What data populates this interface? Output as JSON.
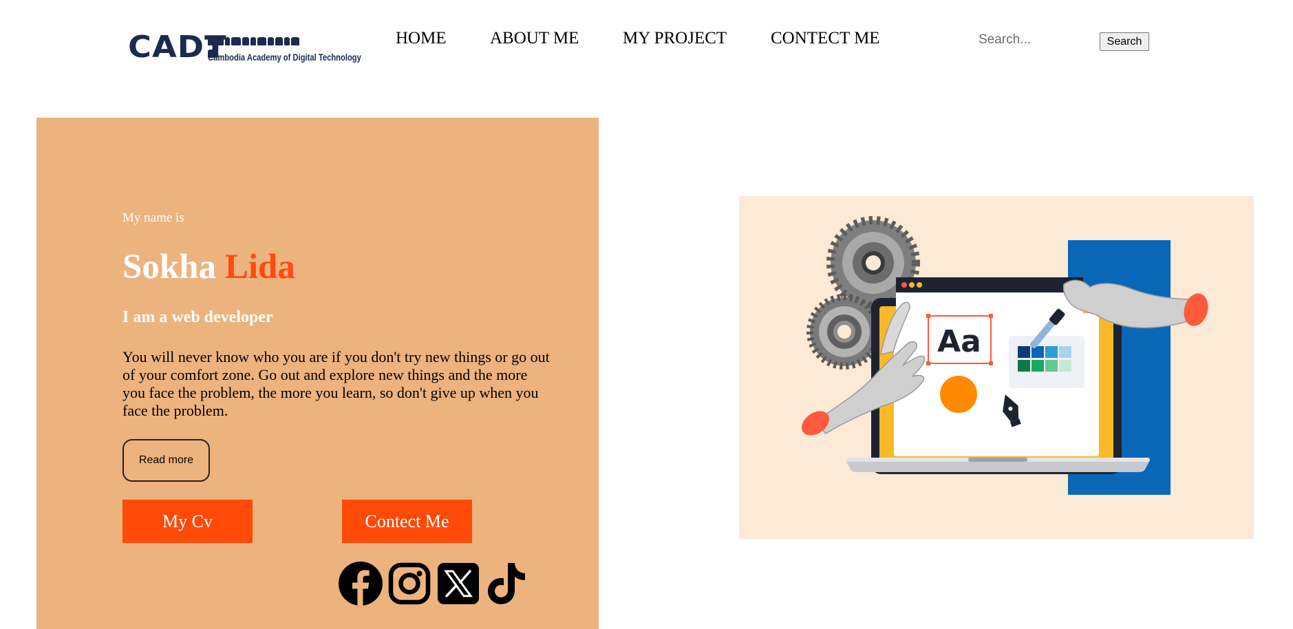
{
  "header": {
    "logo": {
      "mark": "CADT",
      "khmer_text": "បណ្ឌិត្យសភាបច្ចេកវិទ្យាឌីជីថលកម្ពុជា",
      "subtitle": "Cambodia Academy of Digital Technology"
    },
    "nav": [
      {
        "label": "HOME"
      },
      {
        "label": "ABOUT ME"
      },
      {
        "label": "MY PROJECT"
      },
      {
        "label": "CONTECT ME"
      }
    ],
    "search": {
      "placeholder": "Search...",
      "button_label": "Search"
    }
  },
  "hero": {
    "intro": "My name is",
    "first_name": "Sokha",
    "last_name": "Lida",
    "role": "I am a web developer",
    "description": "You will never know who you are if you don't try new things or go out of your comfort zone. Go out and explore new things and the more you face the problem, the more you learn, so don't give up when you face the problem.",
    "read_more_label": "Read more",
    "cv_button_label": "My Cv",
    "contact_button_label": "Contect Me",
    "socials": [
      {
        "icon": "facebook-icon"
      },
      {
        "icon": "instagram-icon"
      },
      {
        "icon": "x-twitter-icon"
      },
      {
        "icon": "tiktok-icon"
      }
    ]
  },
  "illustration": {
    "icon": "web-design-illustration",
    "content_text": "Aa"
  },
  "colors": {
    "panel_background": "#ecb37e",
    "accent": "#ff4a08",
    "illustration_background": "#fce9d6",
    "logo_navy": "#1b2a4e"
  }
}
